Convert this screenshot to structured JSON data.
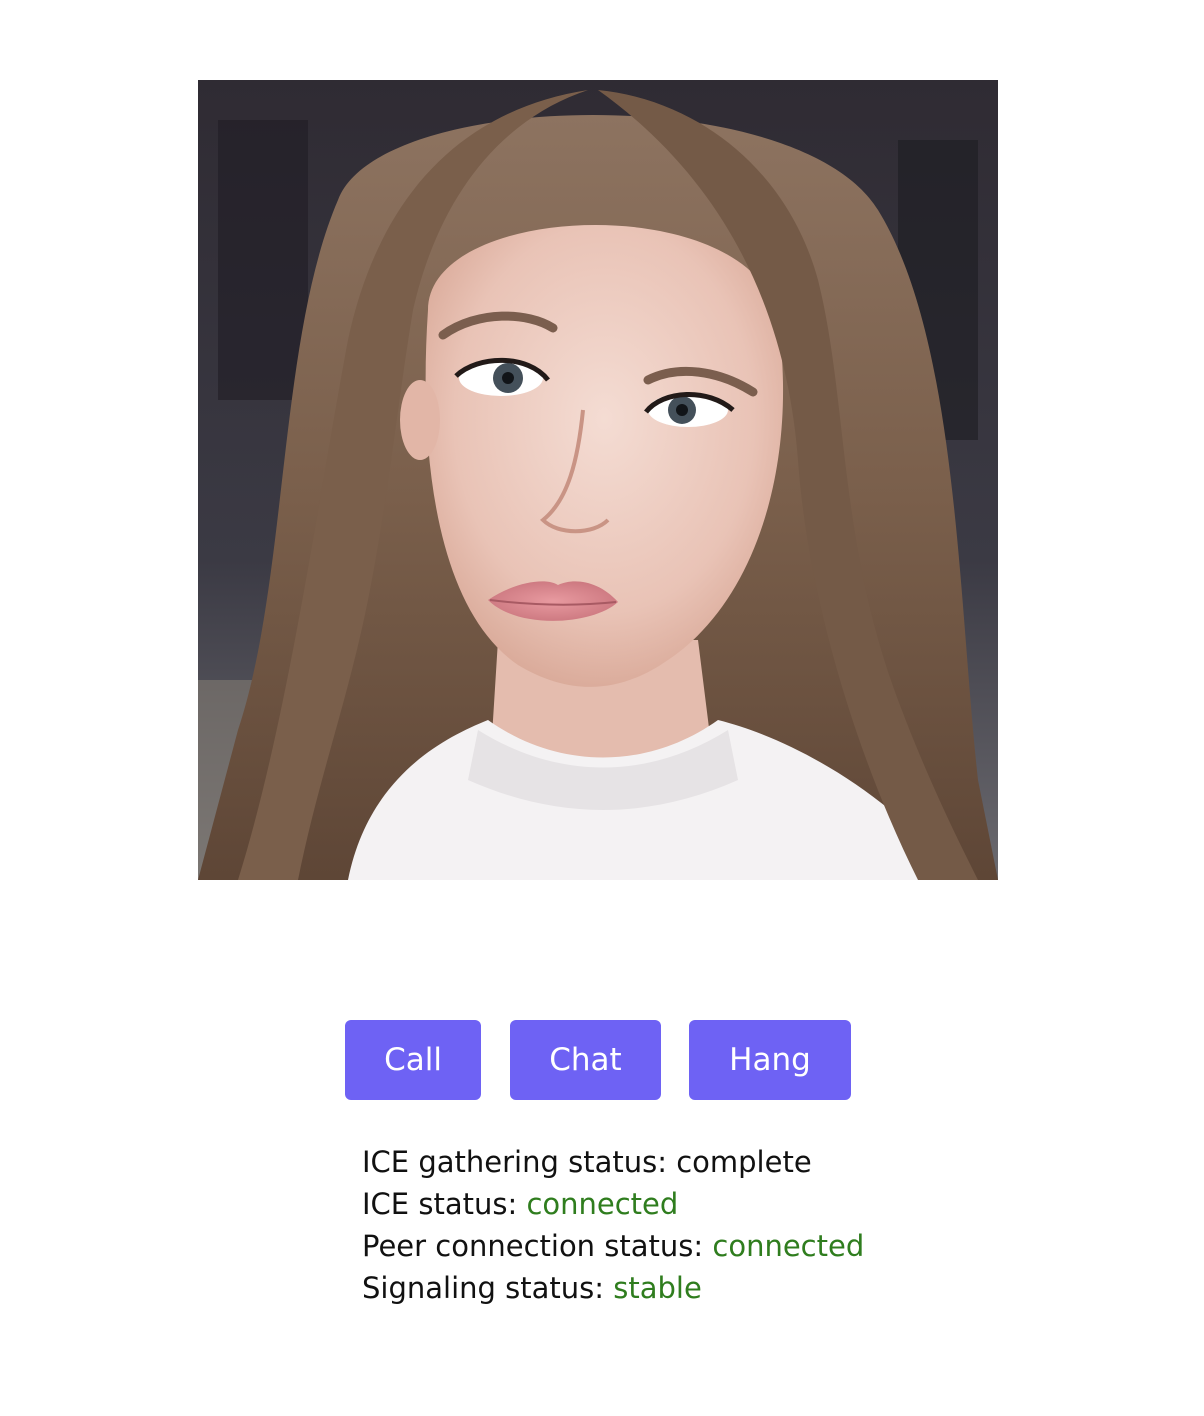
{
  "video": {
    "subject": "remote-video-stream",
    "icon": "video-feed"
  },
  "controls": {
    "call_label": "Call",
    "chat_label": "Chat",
    "hang_label": "Hang",
    "button_color": "#6e62f4",
    "button_text_color": "#ffffff"
  },
  "status": {
    "ice_gathering": {
      "label": "ICE gathering status:",
      "value": "complete"
    },
    "ice": {
      "label": "ICE status:",
      "value": "connected"
    },
    "peer_connection": {
      "label": "Peer connection status:",
      "value": "connected"
    },
    "signaling": {
      "label": "Signaling status:",
      "value": "stable"
    },
    "ok_color": "#2f7d1e",
    "default_color": "#111111"
  }
}
